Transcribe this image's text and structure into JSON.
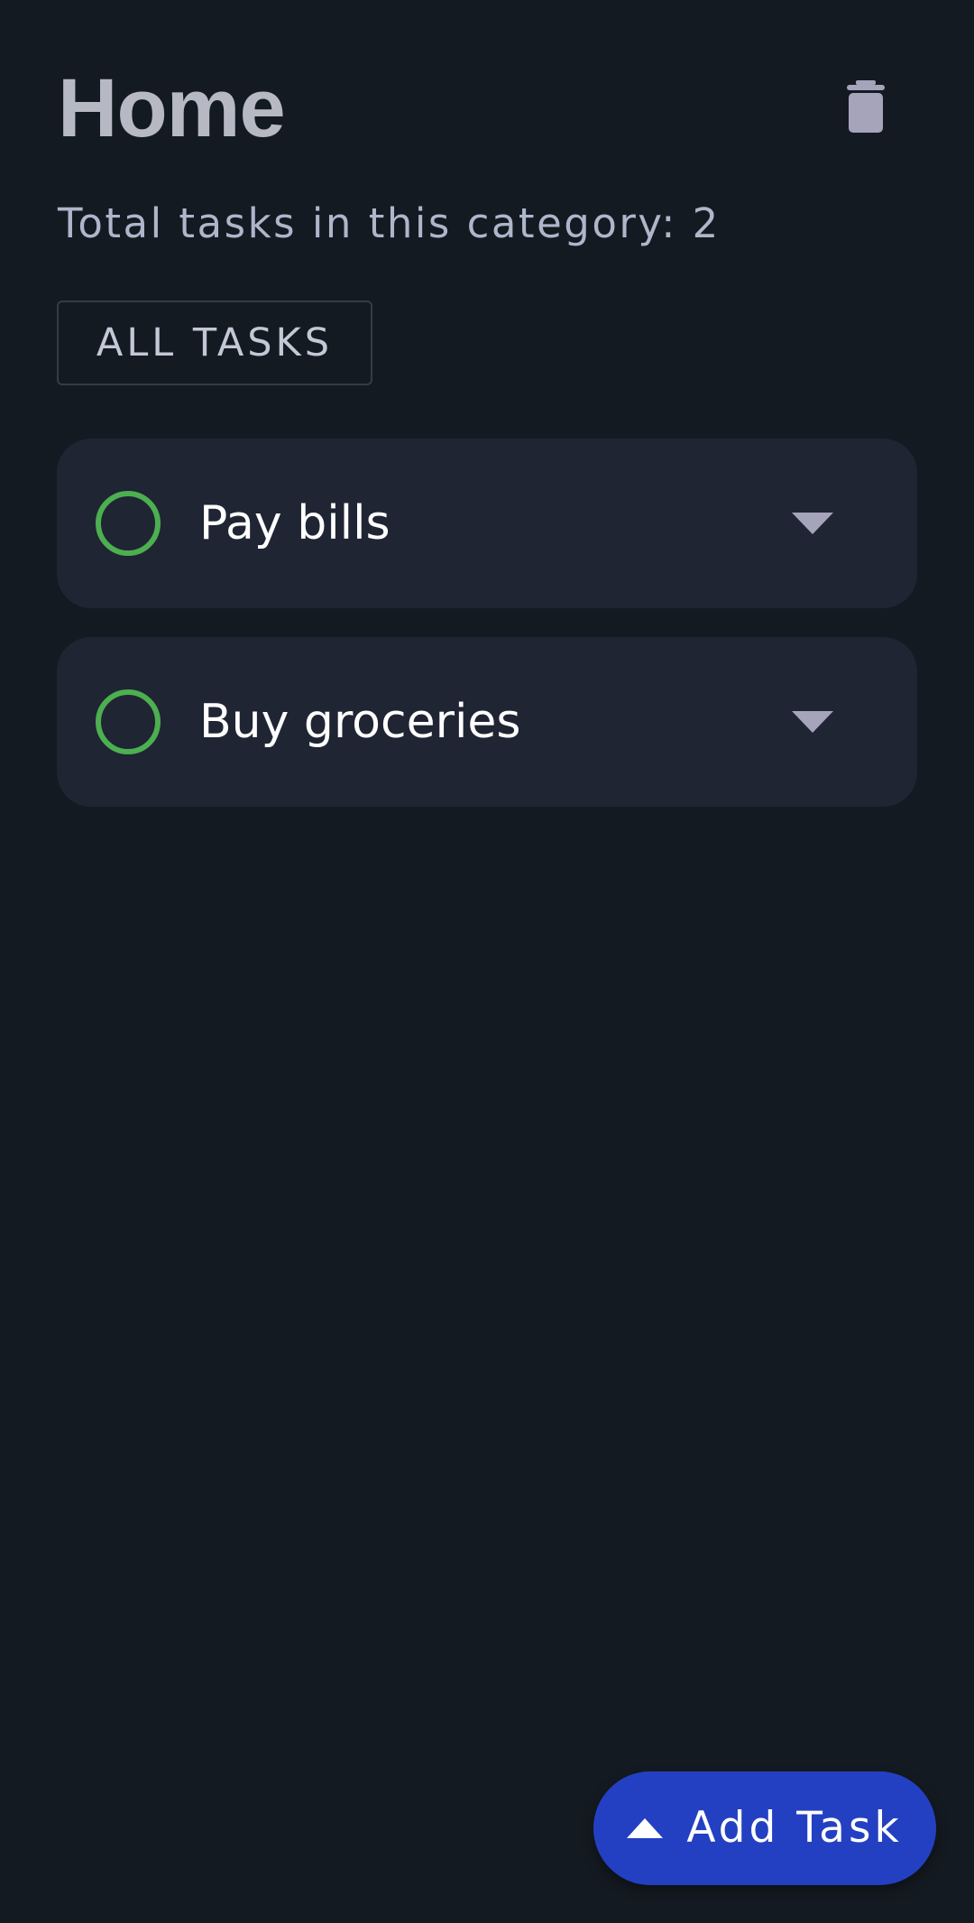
{
  "header": {
    "title": "Home",
    "delete_icon": "trash-icon"
  },
  "summary": {
    "task_count_text": "Total tasks in this category: 2"
  },
  "filter": {
    "label": "ALL TASKS"
  },
  "tasks": [
    {
      "title": "Pay bills",
      "completed": false,
      "expand_icon": "chevron-down-icon"
    },
    {
      "title": "Buy groceries",
      "completed": false,
      "expand_icon": "chevron-down-icon"
    }
  ],
  "fab": {
    "label": "Add Task",
    "icon": "chevron-up-icon"
  },
  "colors": {
    "background": "#141a21",
    "card": "#1f2533",
    "check_ring": "#4caf50",
    "accent": "#2440c2",
    "title": "#b6b9c4",
    "icon_muted": "#a6a4bb"
  }
}
